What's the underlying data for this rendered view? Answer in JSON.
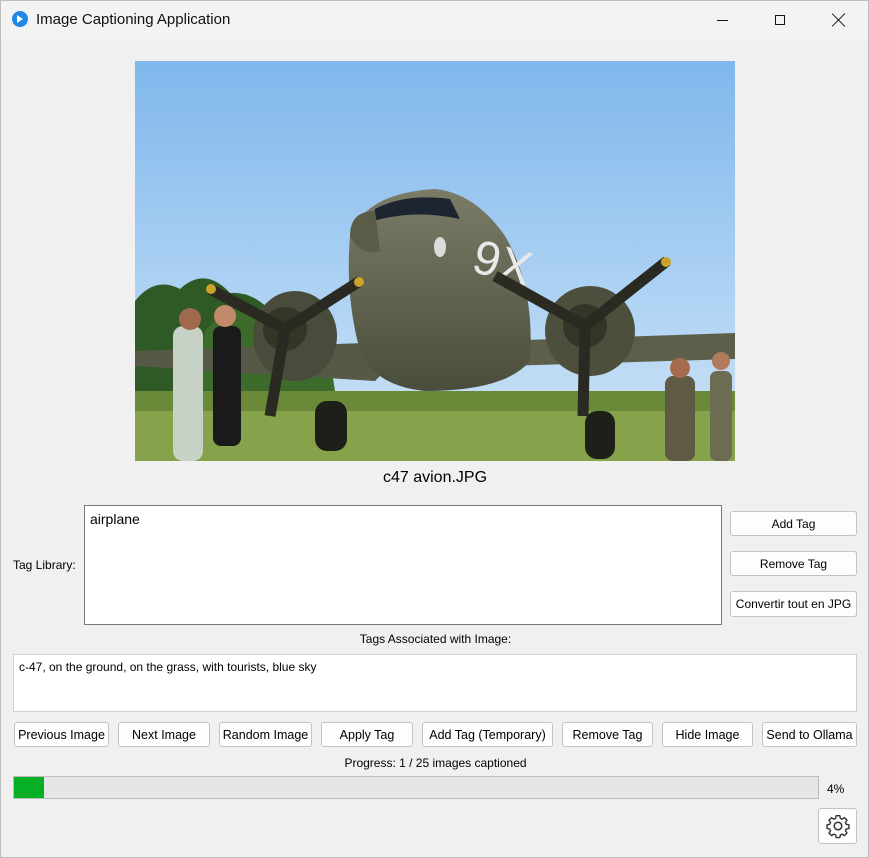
{
  "window": {
    "title": "Image Captioning Application"
  },
  "image": {
    "filename": "c47 avion.JPG",
    "description_icon": "photo"
  },
  "tag_library": {
    "label": "Tag Library:",
    "items": [
      "airplane"
    ]
  },
  "side_buttons": {
    "add_tag": "Add Tag",
    "remove_tag": "Remove Tag",
    "convert_jpg": "Convertir tout en JPG"
  },
  "associated": {
    "label": "Tags Associated with Image:",
    "text": "c-47, on the ground, on the grass, with tourists, blue sky"
  },
  "actions": {
    "previous": "Previous Image",
    "next": "Next Image",
    "random": "Random Image",
    "apply": "Apply Tag",
    "add_temp": "Add Tag (Temporary)",
    "remove": "Remove Tag",
    "hide": "Hide Image",
    "ollama": "Send to Ollama"
  },
  "progress": {
    "label": "Progress: 1 / 25 images captioned",
    "percent_text": "4%",
    "fraction": 0.04,
    "color": "#06b025"
  },
  "settings": {
    "icon": "gear-icon"
  }
}
